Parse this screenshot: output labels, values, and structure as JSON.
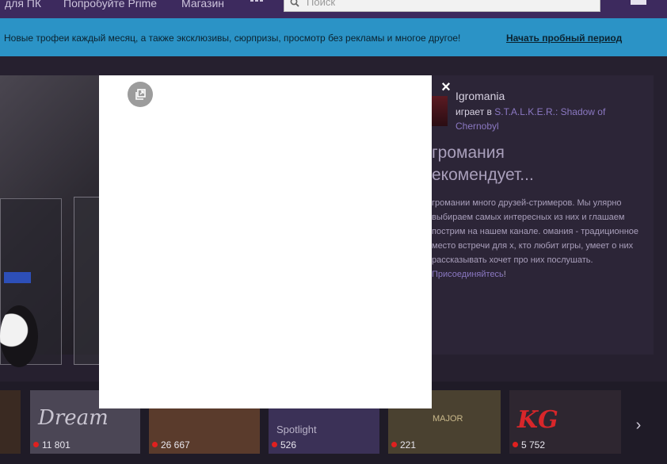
{
  "nav": {
    "item_pc": "для ПК",
    "item_prime": "Попробуйте Prime",
    "item_store": "Магазин",
    "search_placeholder": "Поиск"
  },
  "promo": {
    "text": "Новые трофеи каждый месяц, а также эксклюзивы, сюрпризы, просмотр без рекламы и многое другое!",
    "cta": "Начать пробный период"
  },
  "channel": {
    "name": "Igromania",
    "playing_prefix": "играет в ",
    "game": "S.T.A.L.K.E.R.: Shadow of Chernobyl"
  },
  "recommend": {
    "title_line1": "громания",
    "title_line2": "екомендует...",
    "body": "громании много друзей-стримеров. Мы улярно выбираем самых интересных из них и глашаем пострим на нашем канале. омания - традиционное место встречи для х, кто любит игры, умеет о них рассказывать хочет про них послушать. ",
    "join_link": "Присоединяйтесь",
    "join_suffix": "!"
  },
  "modal": {
    "close_symbol": "×"
  },
  "strip": {
    "thumbs": [
      {
        "count": "11 801",
        "caption": "Dream"
      },
      {
        "count": "26 667",
        "caption": ""
      },
      {
        "count": "526",
        "caption": "Spotlight"
      },
      {
        "count": "221",
        "caption": "MAJOR"
      },
      {
        "count": "5 752",
        "caption": "KG"
      }
    ],
    "next_symbol": "›"
  },
  "colors": {
    "accent": "#8b78c2",
    "promo_bg": "#2b93c6",
    "nav_bg": "#3d2a5e",
    "live": "#e0201f"
  }
}
